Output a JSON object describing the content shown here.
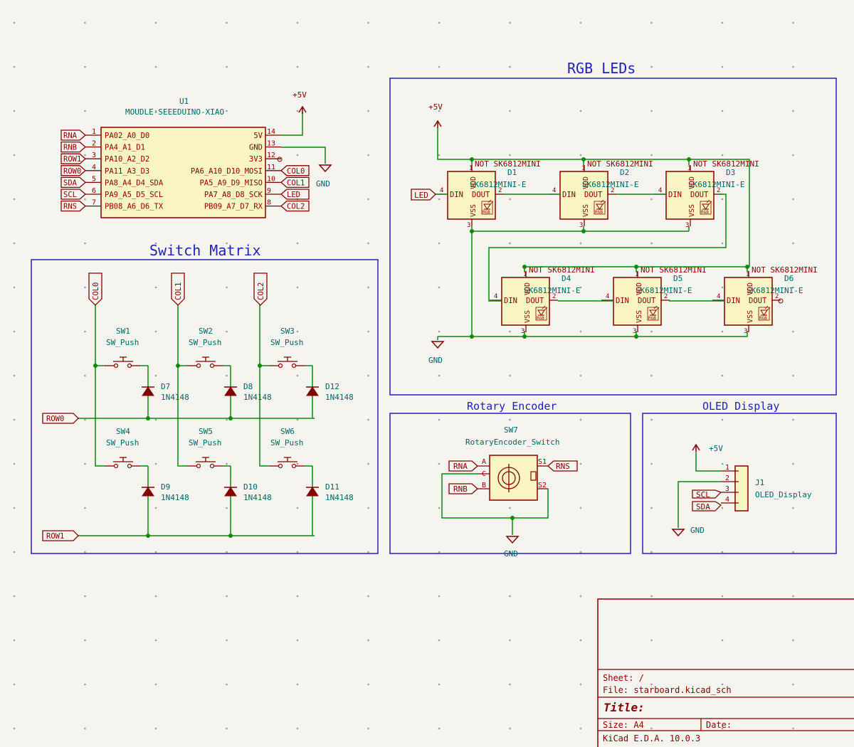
{
  "sheets": {
    "rgb_title": "RGB LEDs",
    "switch_title": "Switch Matrix",
    "rotary_title": "Rotary Encoder",
    "oled_title": "OLED Display"
  },
  "power": {
    "plus5v": "+5V",
    "gnd": "GND"
  },
  "u1": {
    "ref": "U1",
    "value": "MOUDLE-SEEEDUINO-XIAO",
    "left_pins": [
      {
        "num": "1",
        "name": "PA02_A0_D0",
        "net": "RNA"
      },
      {
        "num": "2",
        "name": "PA4_A1_D1",
        "net": "RNB"
      },
      {
        "num": "3",
        "name": "PA10_A2_D2",
        "net": "ROW1"
      },
      {
        "num": "4",
        "name": "PA11_A3_D3",
        "net": "ROW0"
      },
      {
        "num": "5",
        "name": "PA8_A4_D4_SDA",
        "net": "SDA"
      },
      {
        "num": "6",
        "name": "PA9_A5_D5_SCL",
        "net": "SCL"
      },
      {
        "num": "7",
        "name": "PB08_A6_D6_TX",
        "net": "RNS"
      }
    ],
    "right_pins": [
      {
        "num": "14",
        "name": "5V",
        "net": ""
      },
      {
        "num": "13",
        "name": "GND",
        "net": ""
      },
      {
        "num": "12",
        "name": "3V3",
        "net": ""
      },
      {
        "num": "11",
        "name": "PA6_A10_D10_MOSI",
        "net": "COL0"
      },
      {
        "num": "10",
        "name": "PA5_A9_D9_MISO",
        "net": "COL1"
      },
      {
        "num": "9",
        "name": "PA7_A8_D8_SCK",
        "net": "LED"
      },
      {
        "num": "8",
        "name": "PB09_A7_D7_RX",
        "net": "COL2"
      }
    ]
  },
  "leds": {
    "not_label": "NOT SK6812MINI",
    "value": "SK6812MINI-E",
    "items": [
      {
        "ref": "D1"
      },
      {
        "ref": "D2"
      },
      {
        "ref": "D3"
      },
      {
        "ref": "D4"
      },
      {
        "ref": "D5"
      },
      {
        "ref": "D6"
      }
    ],
    "pin_din": "DIN",
    "pin_dout": "DOUT",
    "pin_vdd": "VDD",
    "pin_vss": "VSS",
    "rgb": "RGB",
    "num1": "1",
    "num2": "2",
    "num3": "3",
    "num4": "4",
    "led_net": "LED"
  },
  "matrix": {
    "cols": [
      "COL0",
      "COL1",
      "COL2"
    ],
    "rows": [
      "ROW0",
      "ROW1"
    ],
    "switch_value": "SW_Push",
    "diode_value": "1N4148",
    "switches": [
      "SW1",
      "SW2",
      "SW3",
      "SW4",
      "SW5",
      "SW6"
    ],
    "diodes": [
      "D7",
      "D8",
      "D12",
      "D9",
      "D10",
      "D11"
    ]
  },
  "encoder": {
    "ref": "SW7",
    "value": "RotaryEncoder_Switch",
    "pin_a": "A",
    "pin_c": "C",
    "pin_b": "B",
    "pin_s1": "S1",
    "pin_s2": "S2",
    "net_rna": "RNA",
    "net_rnb": "RNB",
    "net_rns": "RNS"
  },
  "oled": {
    "ref": "J1",
    "value": "OLED_Display",
    "pins": [
      "1",
      "2",
      "3",
      "4"
    ],
    "net_scl": "SCL",
    "net_sda": "SDA"
  },
  "titleblock": {
    "sheet": "Sheet: /",
    "file": "File: starboard.kicad_sch",
    "title": "Title:",
    "size": "Size: A4",
    "date": "Date:",
    "tool": "KiCad E.D.A. 10.0.3"
  },
  "colors": {
    "background": "#f5f4ef",
    "wire": "#0b8a0b",
    "symbol": "#840000",
    "symbol_fill": "#fbf5c3",
    "sheet_border": "#2222bb",
    "text_cyan": "#006464",
    "grid_dot": "#999999"
  }
}
